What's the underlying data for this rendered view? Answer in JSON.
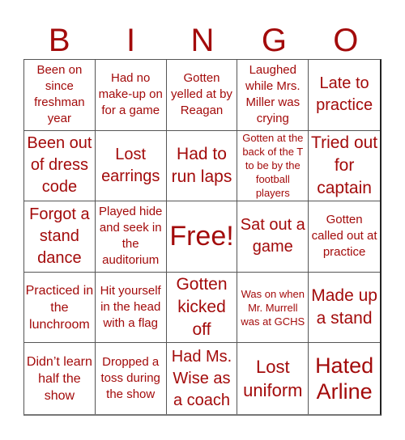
{
  "header": {
    "letters": [
      "B",
      "I",
      "N",
      "G",
      "O"
    ]
  },
  "colors": {
    "text": "#a30b0b",
    "border": "#555555",
    "background": "#ffffff"
  },
  "cells": [
    "Been on since freshman year",
    "Had no make-up on for a game",
    "Gotten yelled at by Reagan",
    "Laughed while Mrs. Miller was crying",
    "Late to practice",
    "Been out of dress code",
    "Lost earrings",
    "Had to run laps",
    "Gotten at the back of the T to be by the football players",
    "Tried out for captain",
    "Forgot a stand dance",
    "Played hide and seek in the auditorium",
    "Free!",
    "Sat out a game",
    "Gotten called out at practice",
    "Practiced in the lunchroom",
    "Hit yourself in the head with a flag",
    "Gotten kicked off",
    "Was on when Mr. Murrell was at GCHS",
    "Made up a stand",
    "Didn’t learn half the show",
    "Dropped a toss during the show",
    "Had Ms. Wise as a coach",
    "Lost uniform",
    "Hated Arline"
  ]
}
